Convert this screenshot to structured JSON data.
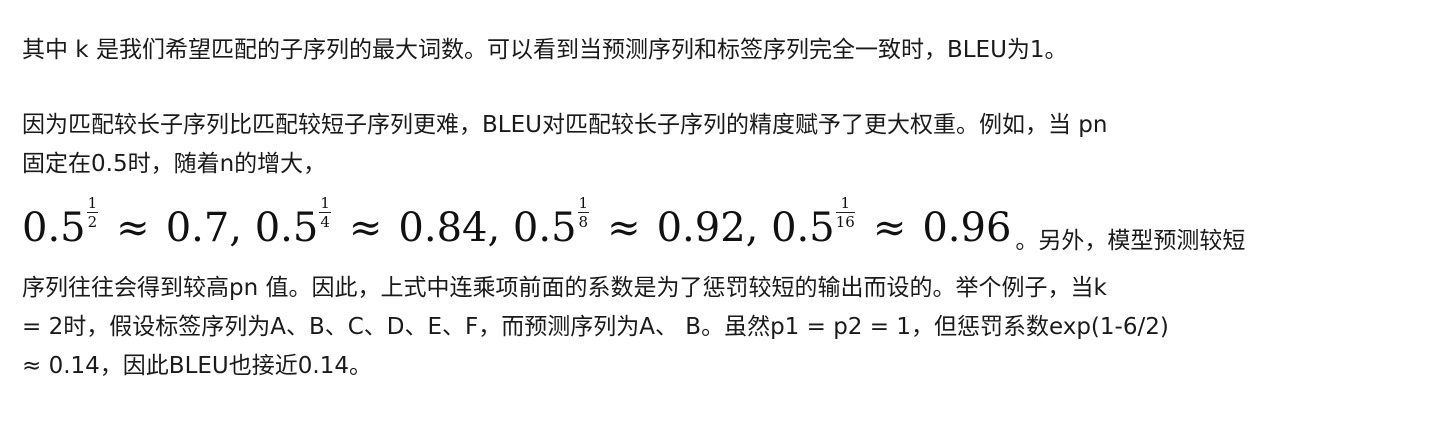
{
  "paragraphs": {
    "p1": "其中 k 是我们希望匹配的子序列的最大词数。可以看到当预测序列和标签序列完全一致时，BLEU为1。",
    "p2_line1": "因为匹配较长子序列比匹配较短子序列更难，BLEU对匹配较长子序列的精度赋予了更大权重。例如，当 pn",
    "p2_line2": "固定在0.5时，随着n的增大，",
    "p2_after_math": "。另外，模型预测较短",
    "p2_line4": "序列往往会得到较高pn 值。因此，上式中连乘项前面的系数是为了惩罚较短的输出而设的。举个例子，当k",
    "p2_line5": "= 2时，假设标签序列为A、B、C、D、E、F，而预测序列为A、 B。虽然p1 = p2 = 1，但惩罚系数exp(1-6/2)",
    "p2_line6": "≈ 0.14，因此BLEU也接近0.14。"
  },
  "formula": {
    "terms": [
      {
        "base": "0.5",
        "exp_num": "1",
        "exp_den": "2",
        "approx": "≈",
        "value": "0.7,"
      },
      {
        "base": "0.5",
        "exp_num": "1",
        "exp_den": "4",
        "approx": "≈",
        "value": "0.84,"
      },
      {
        "base": "0.5",
        "exp_num": "1",
        "exp_den": "8",
        "approx": "≈",
        "value": "0.92,"
      },
      {
        "base": "0.5",
        "exp_num": "1",
        "exp_den": "16",
        "approx": "≈",
        "value": "0.96"
      }
    ]
  }
}
